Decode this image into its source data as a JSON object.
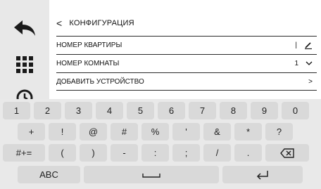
{
  "header": {
    "back_symbol": "<",
    "title": "КОНФИГУРАЦИЯ"
  },
  "rows": [
    {
      "label": "НОМЕР КВАРТИРЫ",
      "value": "|"
    },
    {
      "label": "НОМЕР КОМНАТЫ",
      "value": "1"
    },
    {
      "label": "ДОБАВИТЬ УСТРОЙСТВО",
      "value": ">"
    }
  ],
  "keyboard": {
    "row1": [
      "1",
      "2",
      "3",
      "4",
      "5",
      "6",
      "7",
      "8",
      "9",
      "0"
    ],
    "row2": [
      "+",
      "!",
      "@",
      "#",
      "%",
      "'",
      "&",
      "*",
      "?"
    ],
    "row3": [
      "#+=",
      "(",
      ")",
      "-",
      ":",
      ";",
      "/",
      "."
    ],
    "abc": "ABC"
  },
  "colors": {
    "sidebar": "#e8e8e8",
    "keyboard_bg": "#e9e9e9",
    "key": "#d9d9d9"
  },
  "icons": [
    "back-arrow-icon",
    "grid-icon",
    "clock-icon",
    "pencil-icon",
    "chevron-down-icon",
    "chevron-right-icon",
    "backspace-icon",
    "spacebar-icon",
    "enter-icon"
  ]
}
